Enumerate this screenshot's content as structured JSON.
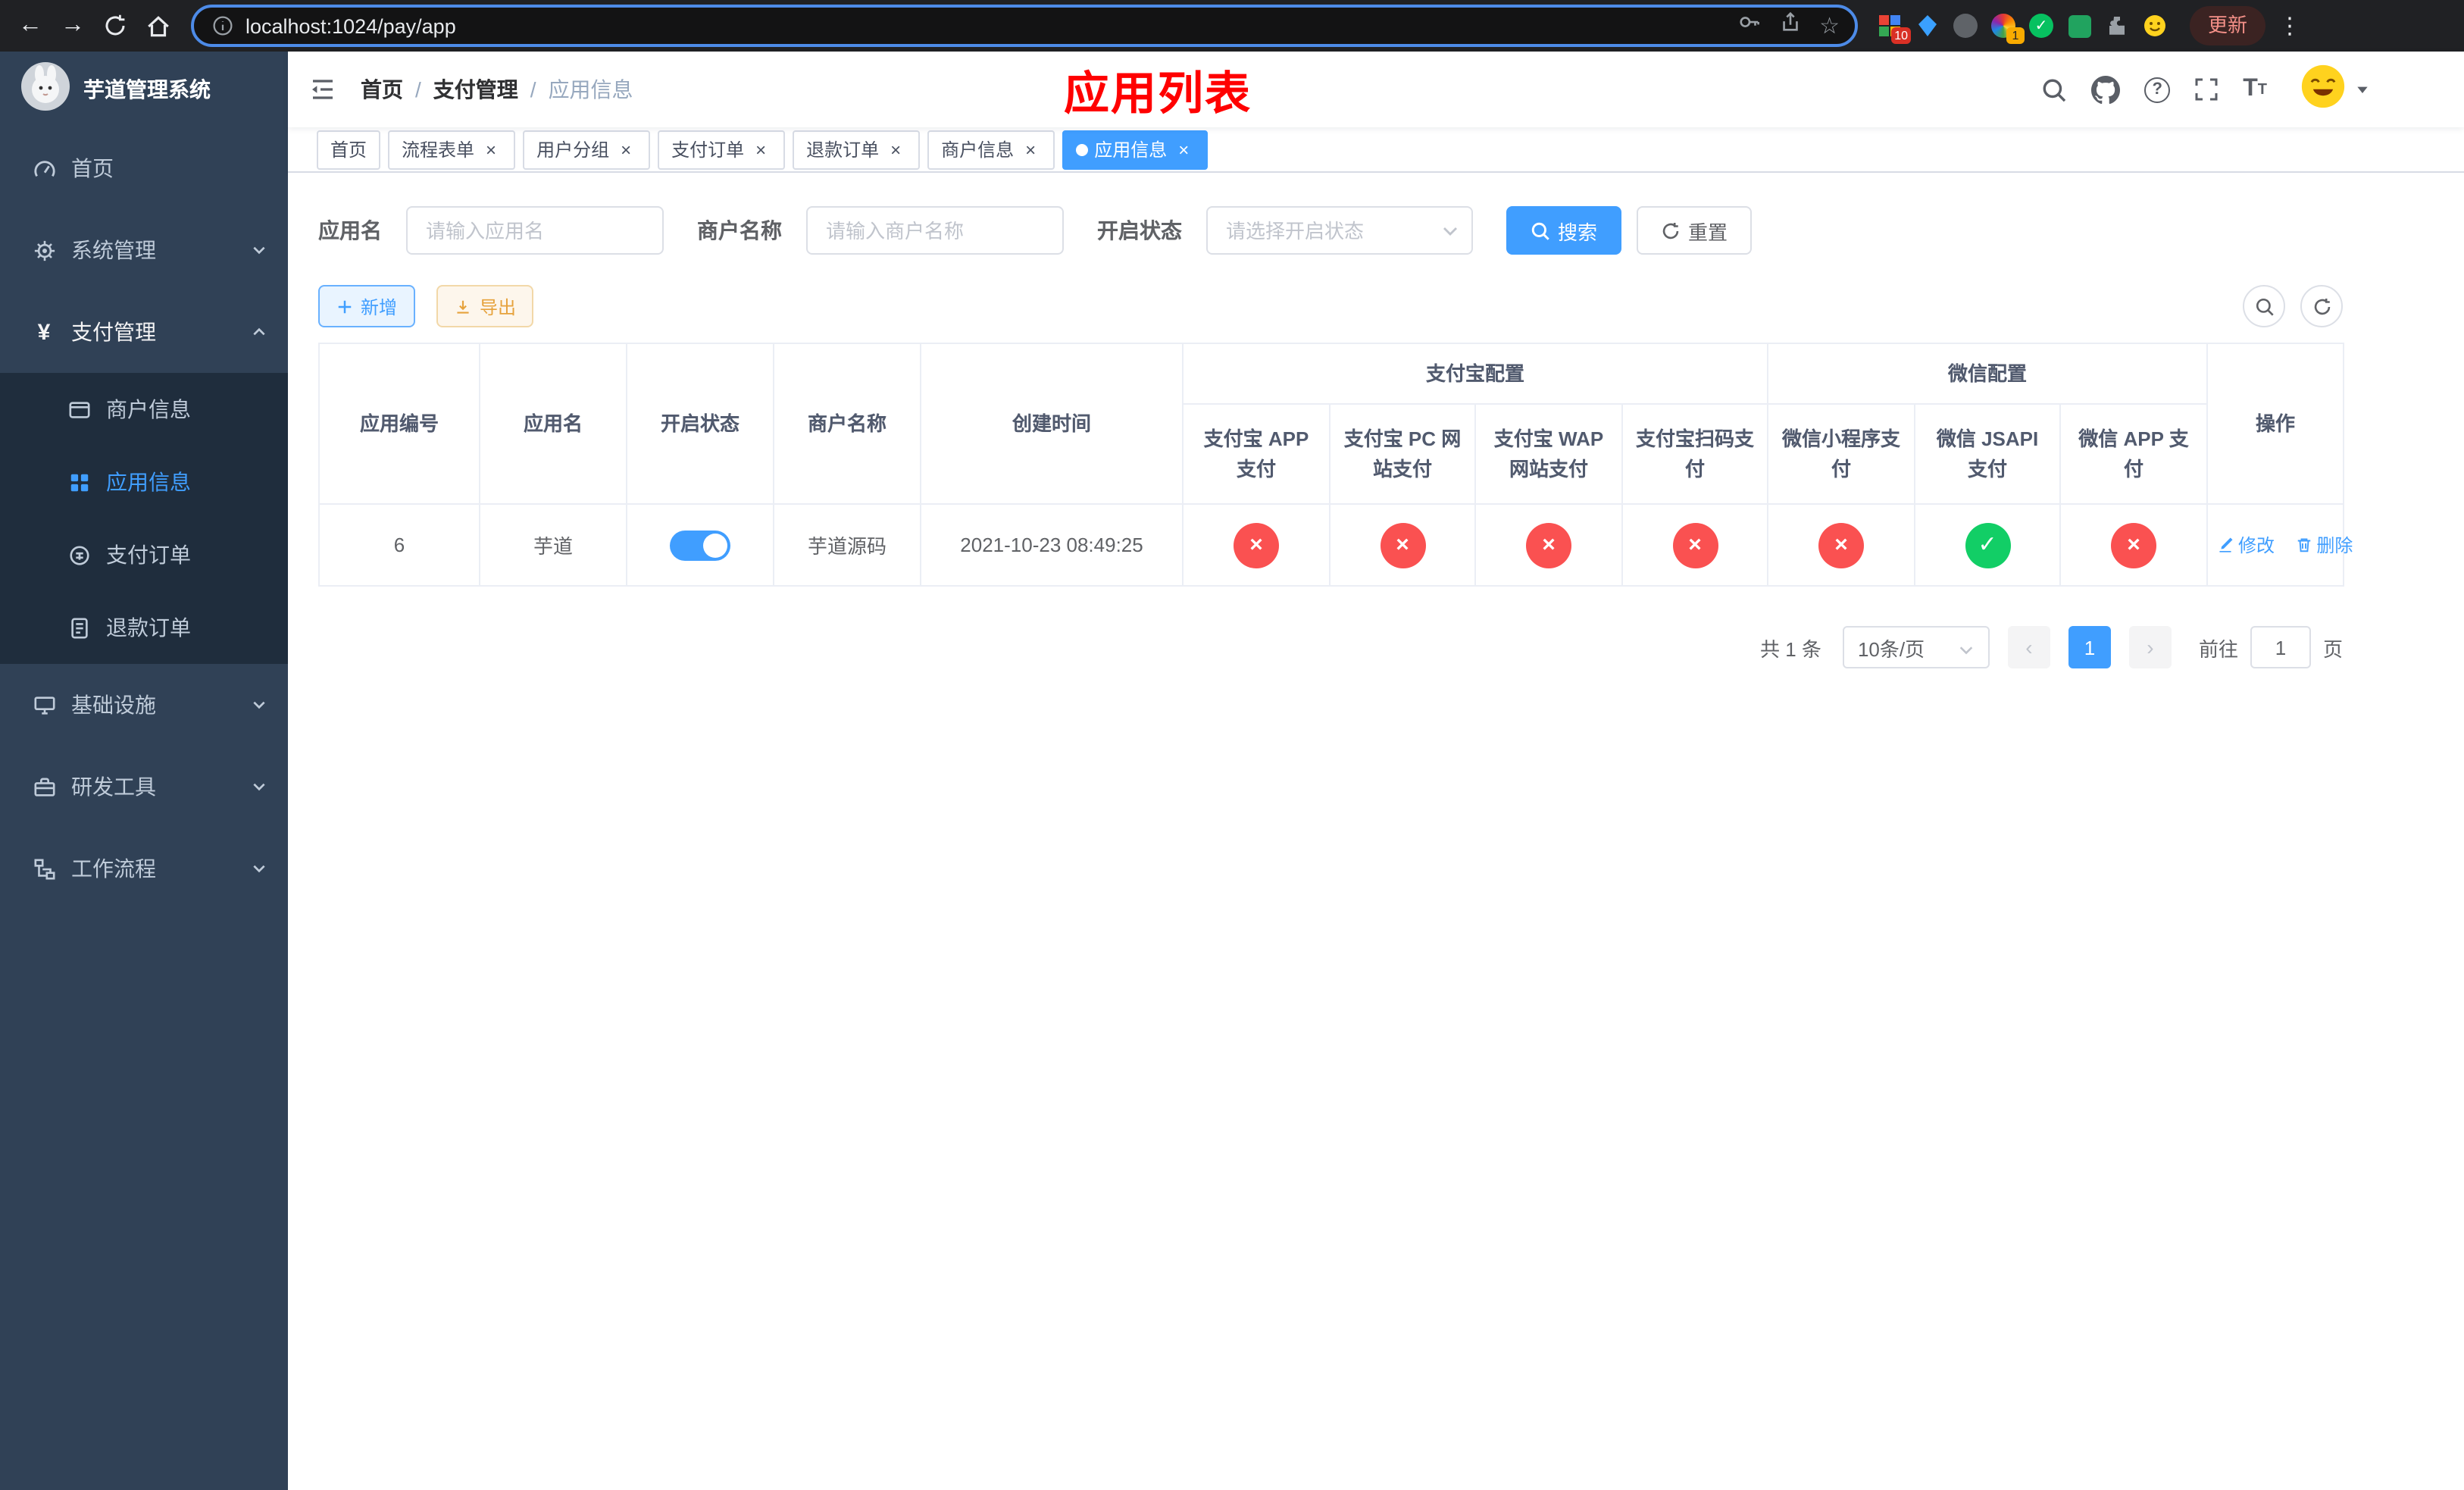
{
  "browser": {
    "url": "localhost:1024/pay/app",
    "update_label": "更新",
    "extension_badge_1": "10",
    "extension_badge_2": "1"
  },
  "sidebar": {
    "logo_title": "芋道管理系统",
    "menu": [
      {
        "label": "首页"
      },
      {
        "label": "系统管理"
      },
      {
        "label": "支付管理"
      },
      {
        "label": "商户信息"
      },
      {
        "label": "应用信息"
      },
      {
        "label": "支付订单"
      },
      {
        "label": "退款订单"
      },
      {
        "label": "基础设施"
      },
      {
        "label": "研发工具"
      },
      {
        "label": "工作流程"
      }
    ]
  },
  "header": {
    "breadcrumb": [
      "首页",
      "支付管理",
      "应用信息"
    ],
    "page_title": "应用列表"
  },
  "tabs": [
    {
      "label": "首页"
    },
    {
      "label": "流程表单"
    },
    {
      "label": "用户分组"
    },
    {
      "label": "支付订单"
    },
    {
      "label": "退款订单"
    },
    {
      "label": "商户信息"
    },
    {
      "label": "应用信息"
    }
  ],
  "filters": {
    "app_name_label": "应用名",
    "app_name_placeholder": "请输入应用名",
    "merchant_label": "商户名称",
    "merchant_placeholder": "请输入商户名称",
    "status_label": "开启状态",
    "status_placeholder": "请选择开启状态",
    "search_label": "搜索",
    "reset_label": "重置"
  },
  "toolbar": {
    "add_label": "新增",
    "export_label": "导出"
  },
  "table": {
    "columns": {
      "app_id": "应用编号",
      "app_name": "应用名",
      "status": "开启状态",
      "merchant": "商户名称",
      "created": "创建时间",
      "alipay_group": "支付宝配置",
      "wechat_group": "微信配置",
      "actions": "操作",
      "channels": [
        "支付宝 APP 支付",
        "支付宝 PC 网站支付",
        "支付宝 WAP 网站支付",
        "支付宝扫码支付",
        "微信小程序支付",
        "微信 JSAPI 支付",
        "微信 APP 支付"
      ]
    },
    "row": {
      "app_id": "6",
      "app_name": "芋道",
      "enabled": true,
      "merchant": "芋道源码",
      "created": "2021-10-23 08:49:25",
      "channels": [
        false,
        false,
        false,
        false,
        false,
        true,
        false
      ],
      "edit_label": "修改",
      "delete_label": "删除"
    }
  },
  "pagination": {
    "total": "共 1 条",
    "page_size": "10条/页",
    "page": "1",
    "goto_label": "前往",
    "goto_value": "1",
    "goto_unit": "页"
  },
  "colors": {
    "primary": "#409eff",
    "danger_circle": "#fa5151",
    "success_circle": "#12ce66",
    "sidebar_bg": "#304156",
    "title_red": "#ff0000"
  }
}
